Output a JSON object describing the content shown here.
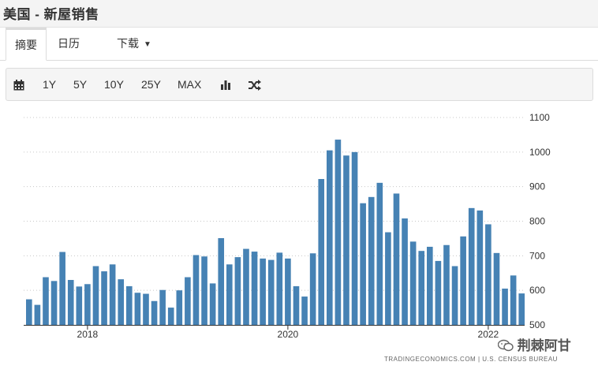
{
  "page": {
    "title": "美国 - 新屋销售"
  },
  "tabs": [
    {
      "label": "摘要",
      "active": true
    },
    {
      "label": "日历",
      "active": false
    },
    {
      "label": "下载",
      "active": false,
      "dropdown": true
    }
  ],
  "toolbar": {
    "calendar_icon": "calendar-icon",
    "ranges": [
      "1Y",
      "5Y",
      "10Y",
      "25Y",
      "MAX"
    ],
    "chart_type_icon": "bar-chart-icon",
    "compare_icon": "shuffle-icon"
  },
  "chart_data": {
    "type": "bar",
    "title": "",
    "xlabel": "",
    "ylabel": "",
    "color": "#4682b4",
    "ylim": [
      500,
      1100
    ],
    "y_ticks": [
      "1100",
      "1000",
      "900",
      "800",
      "700",
      "600",
      "500"
    ],
    "x_ticks": [
      "2018",
      "2020",
      "2022"
    ],
    "grid": true,
    "start": "2017-06",
    "values": [
      574,
      558,
      638,
      627,
      711,
      630,
      611,
      618,
      670,
      655,
      675,
      632,
      612,
      593,
      590,
      569,
      601,
      550,
      600,
      638,
      702,
      698,
      620,
      751,
      675,
      696,
      720,
      712,
      692,
      688,
      709,
      692,
      612,
      582,
      707,
      922,
      1005,
      1036,
      990,
      1000,
      852,
      870,
      911,
      768,
      880,
      808,
      741,
      714,
      726,
      685,
      731,
      670,
      756,
      838,
      831,
      791,
      708,
      605,
      643,
      591
    ],
    "source": "TRADINGECONOMICS.COM | U.S. CENSUS BUREAU"
  },
  "watermark": {
    "text": "荆棘阿甘",
    "icon": "wechat-icon"
  }
}
